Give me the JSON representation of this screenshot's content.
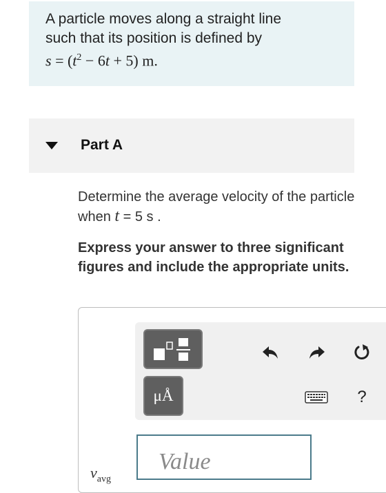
{
  "problem": {
    "line1": "A particle moves along a straight line",
    "line2": "such that its position is defined by",
    "eq_lhs": "s",
    "eq_eq": " = (",
    "eq_t": "t",
    "eq_sup": "2",
    "eq_rest": " − 6",
    "eq_t2": "t",
    "eq_tail": " + 5) m."
  },
  "part": {
    "title": "Part A"
  },
  "question": {
    "text_before": "Determine the average velocity of the particle when ",
    "variable": "t",
    "text_after": " = 5  s .",
    "instruction": "Express your answer to three significant figures and include the appropriate units."
  },
  "toolbar": {
    "units_label": "μÅ",
    "help_label": "?",
    "icons": [
      "templates-icon",
      "undo-icon",
      "redo-icon",
      "reset-icon",
      "keyboard-icon",
      "help-icon"
    ]
  },
  "answer": {
    "variable": "v",
    "subscript": "avg",
    "placeholder": "Value"
  },
  "colors": {
    "problem_bg": "#e9f3f5",
    "part_header_bg": "#f2f2f2",
    "toolbar_bg": "#f0f0f0",
    "tool_button_bg": "#5f5f5f",
    "input_border": "#4a7a8a"
  }
}
